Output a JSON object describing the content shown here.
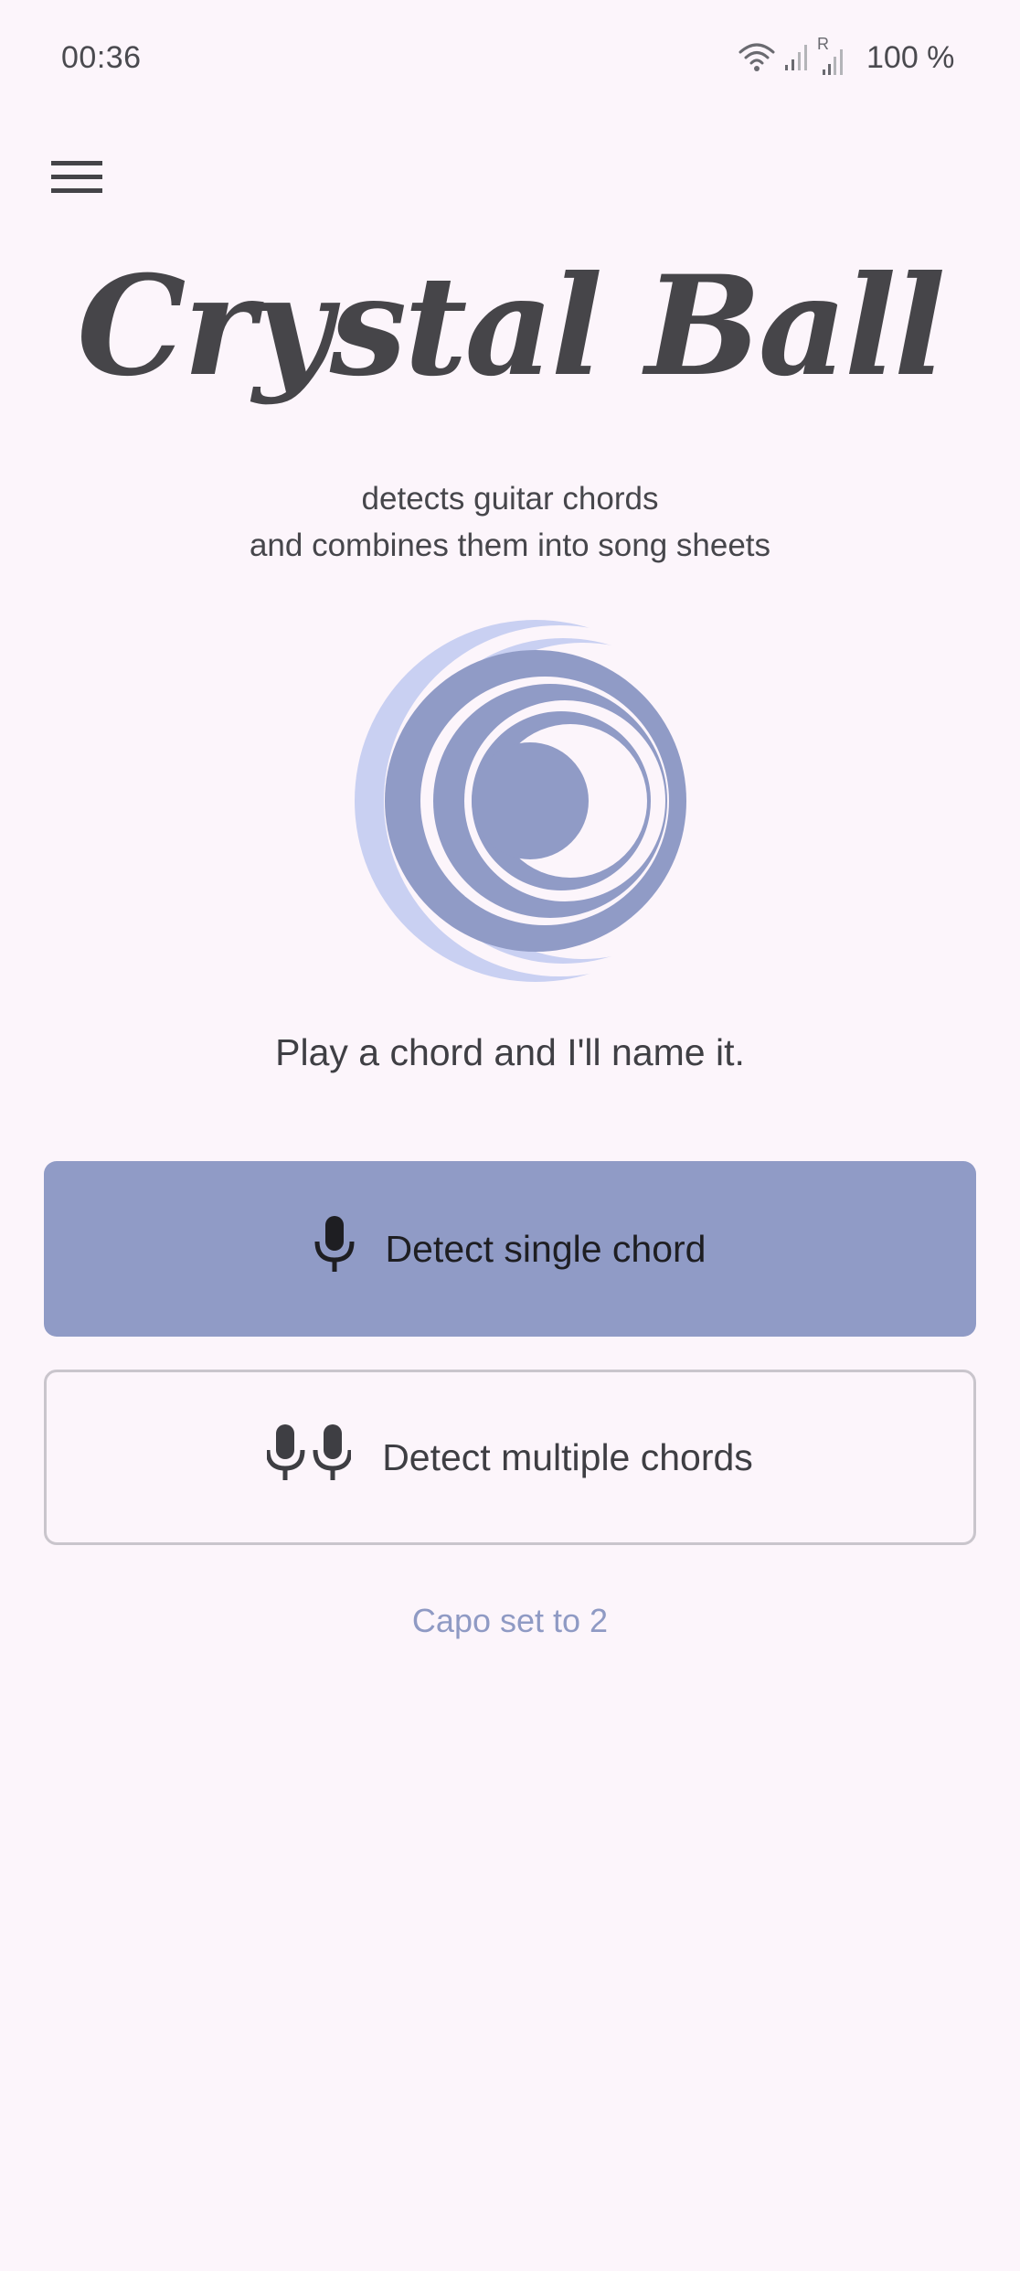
{
  "status_bar": {
    "time": "00:36",
    "battery": "100 %",
    "roaming_indicator": "R",
    "icons": [
      "wifi-icon",
      "signal-icon",
      "roaming-signal-icon"
    ]
  },
  "menu": {
    "icon": "hamburger-menu-icon"
  },
  "header": {
    "title": "Crystal Ball",
    "tagline_line1": "detects guitar chords",
    "tagline_line2": "and combines them into song sheets"
  },
  "main": {
    "prompt": "Play a chord and I'll name it.",
    "detect_single_label": "Detect single chord",
    "detect_multiple_label": "Detect multiple chords",
    "capo_status": "Capo set to 2"
  },
  "colors": {
    "background": "#fcf5fb",
    "accent": "#909bc6",
    "accent_light": "#c9d0f2",
    "text": "#434348"
  }
}
